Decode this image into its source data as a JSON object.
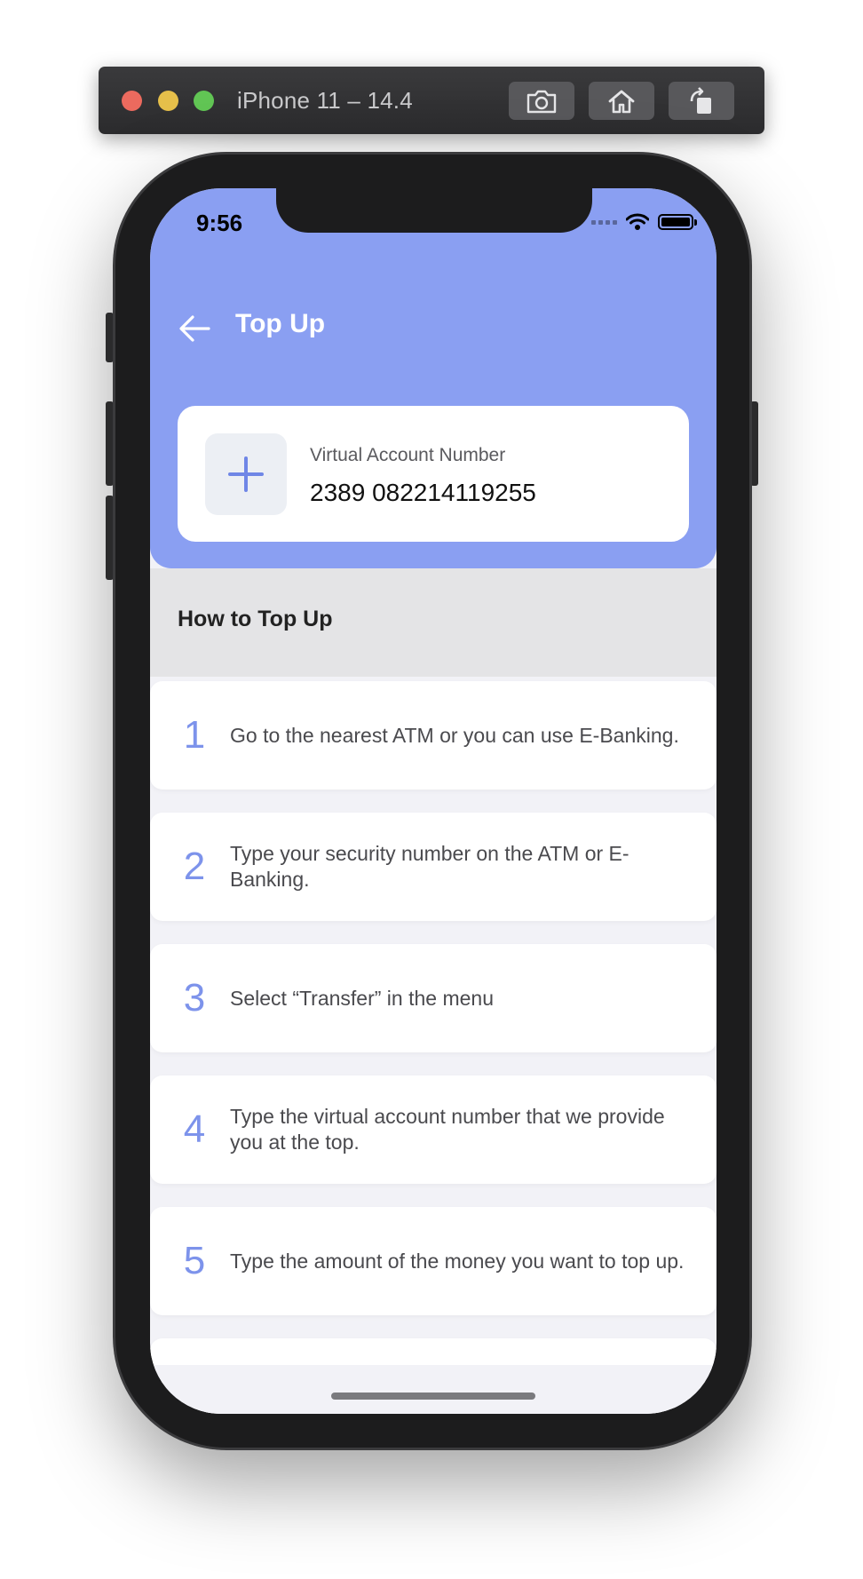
{
  "simulator": {
    "title": "iPhone 11 – 14.4"
  },
  "status_bar": {
    "time": "9:56"
  },
  "header": {
    "title": "Top Up"
  },
  "virtual_account": {
    "label": "Virtual Account Number",
    "number": "2389 082214119255"
  },
  "how_to": {
    "title": "How to Top Up",
    "steps": [
      {
        "num": "1",
        "text": "Go to the nearest ATM or you can use E-Banking."
      },
      {
        "num": "2",
        "text": "Type your security number on the ATM or E-Banking."
      },
      {
        "num": "3",
        "text": "Select “Transfer” in the menu"
      },
      {
        "num": "4",
        "text": "Type the virtual account number that we provide you at the top."
      },
      {
        "num": "5",
        "text": "Type the amount of the money you want to top up."
      },
      {
        "num": "",
        "text": ""
      }
    ]
  },
  "colors": {
    "accent": "#8a9ff2",
    "step_number": "#7d93eb"
  }
}
